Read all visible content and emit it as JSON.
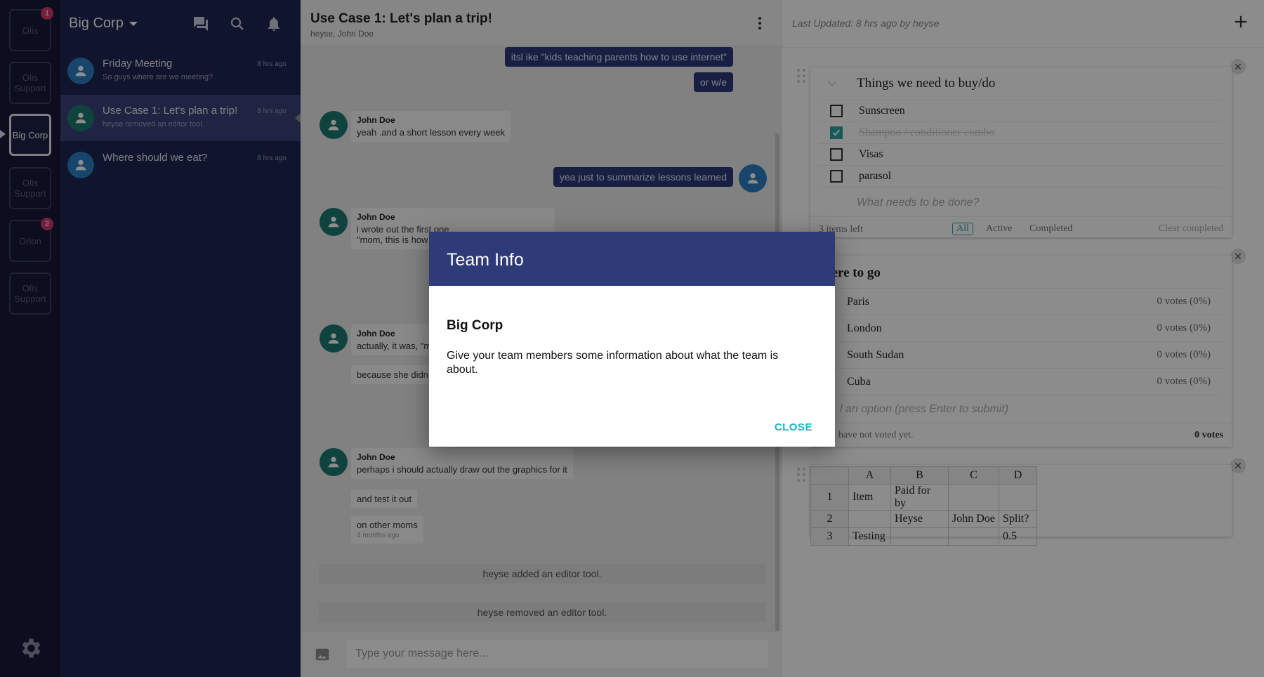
{
  "rail": {
    "teams": [
      {
        "label": "Olis",
        "badge": "1"
      },
      {
        "label": "Olis Support",
        "badge": ""
      },
      {
        "label": "Big Corp",
        "badge": ""
      },
      {
        "label": "Olis Support",
        "badge": ""
      },
      {
        "label": "Orion",
        "badge": "2"
      },
      {
        "label": "Olis Support",
        "badge": ""
      }
    ]
  },
  "channels": {
    "team_name": "Big Corp",
    "items": [
      {
        "name": "Friday Meeting",
        "preview": "So guys where are we meeting?",
        "time": "8 hrs ago"
      },
      {
        "name": "Use Case 1: Let's plan a trip!",
        "preview": "heyse removed an editor tool.",
        "time": "8 hrs ago"
      },
      {
        "name": "Where should we eat?",
        "preview": "",
        "time": "8 hrs ago"
      }
    ]
  },
  "chat": {
    "title": "Use Case 1: Let's plan a trip!",
    "members": "heyse, John Doe",
    "messages": {
      "out1": "itsl ike \"kids teaching parents how to use internet\"",
      "out2": "or w/e",
      "in1_author": "John Doe",
      "in1_text": "yeah .and a short lesson every week",
      "out3": "yea just to summarize lessons learned",
      "in2_author": "John Doe",
      "in2_line1": "i wrote out the first one",
      "in2_line2": "\"mom, this is how",
      "in3_author": "John Doe",
      "in3_line1": "actually, it was, \"m",
      "in3_line2": "because she didn",
      "in4_author": "John Doe",
      "in4_line1": "perhaps i should actually draw out the graphics for it",
      "in4_line2": "and test it out",
      "in4_line3": "on other moms",
      "in4_time": "4 months ago"
    },
    "system": [
      "heyse added an editor tool.",
      "heyse removed an editor tool."
    ],
    "composer_placeholder": "Type your message here..."
  },
  "tools": {
    "last_updated": "Last Updated: 8 hrs ago by heyse",
    "todo": {
      "title": "Things we need to buy/do",
      "items": [
        {
          "text": "Sunscreen",
          "done": false
        },
        {
          "text": "Shampoo / conditioner combo",
          "done": true
        },
        {
          "text": "Visas",
          "done": false
        },
        {
          "text": "parasol",
          "done": false
        }
      ],
      "new_placeholder": "What needs to be done?",
      "items_left": "3 items left",
      "filter_all": "All",
      "filter_active": "Active",
      "filter_completed": "Completed",
      "clear_completed": "Clear completed"
    },
    "poll": {
      "title": "here to go",
      "options": [
        {
          "name": "Paris",
          "votes": "0 votes (0%)"
        },
        {
          "name": "London",
          "votes": "0 votes (0%)"
        },
        {
          "name": "South Sudan",
          "votes": "0 votes (0%)"
        },
        {
          "name": "Cuba",
          "votes": "0 votes (0%)"
        }
      ],
      "add_placeholder": "l an option (press Enter to submit)",
      "not_voted": "have not voted yet.",
      "total": "0 votes"
    },
    "sheet": {
      "columns": [
        "A",
        "B",
        "C",
        "D"
      ],
      "rows": [
        [
          "1",
          "Item",
          "Paid for by",
          "",
          ""
        ],
        [
          "2",
          "",
          "Heyse",
          "John Doe",
          "Split?"
        ],
        [
          "3",
          "Testing",
          "",
          "",
          "0.5"
        ]
      ]
    }
  },
  "modal": {
    "title": "Team Info",
    "team_name": "Big Corp",
    "description": "Give your team members some information about what the team is about.",
    "close_label": "CLOSE"
  }
}
